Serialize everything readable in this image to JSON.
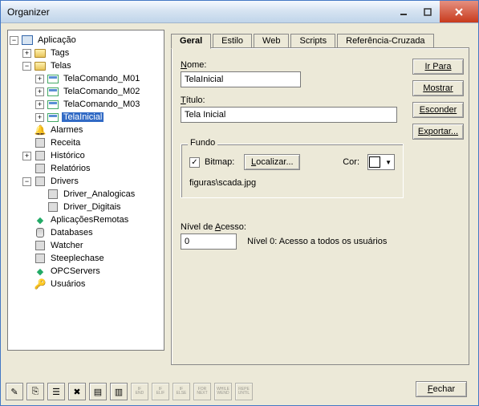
{
  "window": {
    "title": "Organizer"
  },
  "tabs": [
    "Geral",
    "Estilo",
    "Web",
    "Scripts",
    "Referência-Cruzada"
  ],
  "tabs_accel": [
    "G",
    "E",
    "W",
    "S",
    "R"
  ],
  "active_tab": 0,
  "buttons": {
    "ir_para": "Ir Para",
    "mostrar": "Mostrar",
    "esconder": "Esconder",
    "exportar": "Exportar...",
    "fechar": "Fechar",
    "localizar": "Localizar..."
  },
  "buttons_accel": {
    "ir_para": "I",
    "mostrar": "M",
    "esconder": "E",
    "exportar": "x",
    "fechar": "F",
    "localizar": "L"
  },
  "form": {
    "nome_label": "Nome:",
    "nome_accel": "N",
    "nome_value": "TelaInicial",
    "titulo_label": "Título:",
    "titulo_accel": "T",
    "titulo_value": "Tela Inicial"
  },
  "fundo": {
    "legend": "Fundo",
    "bitmap_label": "Bitmap:",
    "bitmap_accel": "B",
    "bitmap_checked": true,
    "cor_label": "Cor:",
    "cor_value": "#ffffff",
    "path": "figuras\\scada.jpg"
  },
  "access": {
    "label": "Nível de Acesso:",
    "accel": "A",
    "value": "0",
    "desc": "Nível 0: Acesso a todos os usuários"
  },
  "tree": [
    {
      "depth": 0,
      "exp": "-",
      "icon": "app",
      "label": "Aplicação"
    },
    {
      "depth": 1,
      "exp": "+",
      "icon": "folder",
      "label": "Tags"
    },
    {
      "depth": 1,
      "exp": "-",
      "icon": "folder",
      "label": "Telas"
    },
    {
      "depth": 2,
      "exp": "+",
      "icon": "screen",
      "label": "TelaComando_M01"
    },
    {
      "depth": 2,
      "exp": "+",
      "icon": "screen",
      "label": "TelaComando_M02"
    },
    {
      "depth": 2,
      "exp": "+",
      "icon": "screen",
      "label": "TelaComando_M03"
    },
    {
      "depth": 2,
      "exp": "+",
      "icon": "screen",
      "label": "TelaInicial",
      "selected": true
    },
    {
      "depth": 1,
      "exp": "",
      "icon": "bell",
      "label": "Alarmes"
    },
    {
      "depth": 1,
      "exp": "",
      "icon": "misc",
      "label": "Receita"
    },
    {
      "depth": 1,
      "exp": "+",
      "icon": "misc",
      "label": "Histórico"
    },
    {
      "depth": 1,
      "exp": "",
      "icon": "misc",
      "label": "Relatórios"
    },
    {
      "depth": 1,
      "exp": "-",
      "icon": "misc",
      "label": "Drivers"
    },
    {
      "depth": 2,
      "exp": "",
      "icon": "misc",
      "label": "Driver_Analogicas"
    },
    {
      "depth": 2,
      "exp": "",
      "icon": "misc",
      "label": "Driver_Digitais"
    },
    {
      "depth": 1,
      "exp": "",
      "icon": "srv",
      "label": "AplicaçõesRemotas"
    },
    {
      "depth": 1,
      "exp": "",
      "icon": "db",
      "label": "Databases"
    },
    {
      "depth": 1,
      "exp": "",
      "icon": "misc",
      "label": "Watcher"
    },
    {
      "depth": 1,
      "exp": "",
      "icon": "misc",
      "label": "Steeplechase"
    },
    {
      "depth": 1,
      "exp": "",
      "icon": "srv",
      "label": "OPCServers"
    },
    {
      "depth": 1,
      "exp": "",
      "icon": "key",
      "label": "Usuários"
    }
  ],
  "toolbar_icons": [
    {
      "name": "edit-icon",
      "glyph": "✎",
      "disabled": false
    },
    {
      "name": "copy-icon",
      "glyph": "⎘",
      "disabled": false
    },
    {
      "name": "props-icon",
      "glyph": "☰",
      "disabled": false
    },
    {
      "name": "delete-icon",
      "glyph": "✖",
      "disabled": false
    },
    {
      "name": "sort-asc-icon",
      "glyph": "▤",
      "disabled": false
    },
    {
      "name": "sort-desc-icon",
      "glyph": "▥",
      "disabled": false
    },
    {
      "name": "if-end-icon",
      "text": "IF\nEND",
      "disabled": true
    },
    {
      "name": "if-elif-icon",
      "text": "IF\nELIF",
      "disabled": true
    },
    {
      "name": "if-else-icon",
      "text": "IF\nELSE",
      "disabled": true
    },
    {
      "name": "for-next-icon",
      "text": "FOR\nNEXT",
      "disabled": true
    },
    {
      "name": "while-wend-icon",
      "text": "WHILE\nWEND",
      "disabled": true
    },
    {
      "name": "repeat-until-icon",
      "text": "REPE\nUNTIL",
      "disabled": true
    }
  ]
}
